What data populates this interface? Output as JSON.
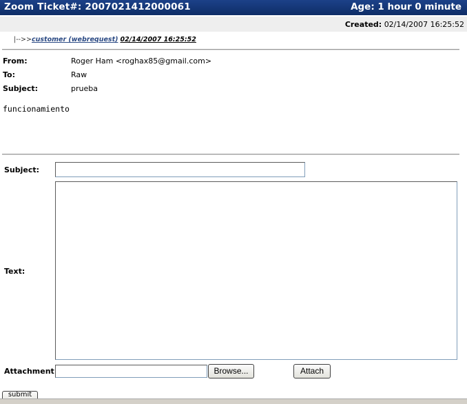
{
  "header": {
    "title": "Zoom Ticket#: 2007021412000061",
    "age": "Age: 1 hour 0 minute"
  },
  "created": {
    "label": "Created:",
    "value": "02/14/2007 16:25:52"
  },
  "article": {
    "prefix": "|-->>",
    "sender_link": "customer (webrequest)",
    "date_link": "02/14/2007 16:25:52"
  },
  "message": {
    "from_label": "From:",
    "from_value": "Roger Ham <roghax85@gmail.com>",
    "to_label": "To:",
    "to_value": "Raw",
    "subject_label": "Subject:",
    "subject_value": "prueba",
    "body": "funcionamiento"
  },
  "form": {
    "subject_label": "Subject:",
    "subject_value": "",
    "text_label": "Text:",
    "text_value": "",
    "attachment_label": "Attachment:",
    "attachment_value": "",
    "browse_label": "Browse...",
    "attach_label": "Attach",
    "submit_label": "submit"
  }
}
